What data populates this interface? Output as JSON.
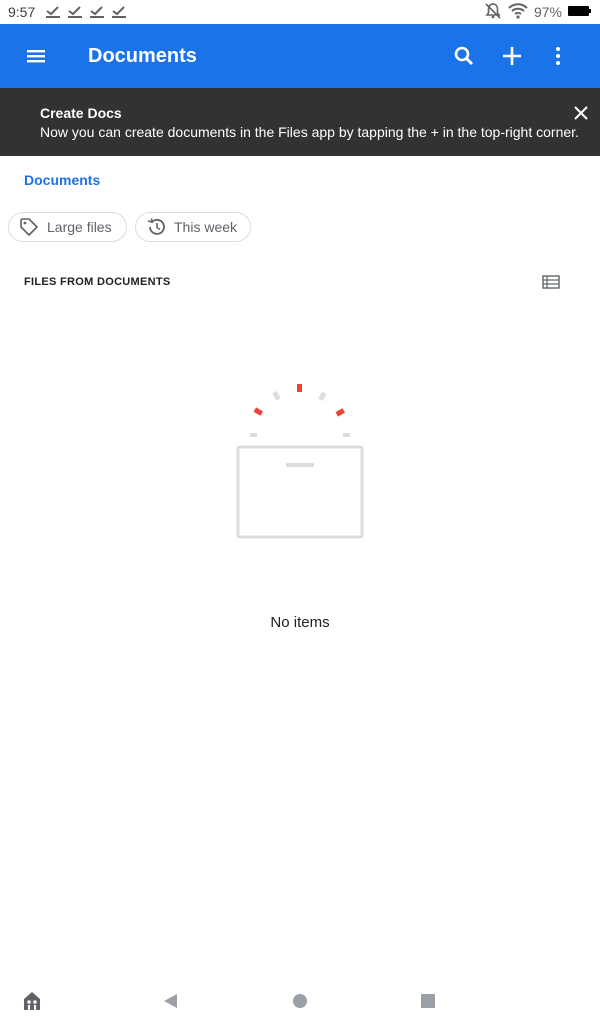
{
  "status_bar": {
    "time": "9:57",
    "battery": "97%"
  },
  "app_bar": {
    "title": "Documents",
    "color": "#1a73e8"
  },
  "banner": {
    "title": "Create Docs",
    "text": "Now you can create documents in the Files app by tapping the + in the top-right corner."
  },
  "breadcrumb": {
    "label": "Documents"
  },
  "chips": [
    {
      "label": "Large files",
      "icon": "tag-icon"
    },
    {
      "label": "This week",
      "icon": "history-icon"
    }
  ],
  "section": {
    "header": "FILES FROM DOCUMENTS"
  },
  "empty_state": {
    "text": "No items"
  }
}
